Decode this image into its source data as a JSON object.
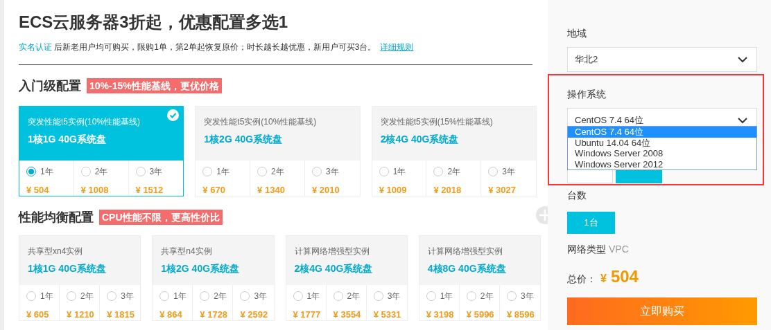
{
  "header": {
    "title": "ECS云服务器3折起，优惠配置多选1",
    "notice_link": "实名认证",
    "notice": "后新老用户均可购买，限购1单，第2单起恢复原价；时长越长越优惠，新用户可买3台。",
    "rules_link": "详细规则"
  },
  "sections": [
    {
      "title": "入门级配置",
      "tag": "10%-15%性能基线，更优价格",
      "cards": [
        {
          "type": "突发性能t5实例(10%性能基线)",
          "spec": "1核1G 40G系统盘",
          "selected": true,
          "options": [
            {
              "term": "1年",
              "price": "¥ 504",
              "selected": true
            },
            {
              "term": "2年",
              "price": "¥ 1008",
              "selected": false
            },
            {
              "term": "3年",
              "price": "¥ 1512",
              "selected": false
            }
          ]
        },
        {
          "type": "突发性能t5实例(10%性能基线)",
          "spec": "1核2G 40G系统盘",
          "selected": false,
          "options": [
            {
              "term": "1年",
              "price": "¥ 670",
              "selected": false
            },
            {
              "term": "2年",
              "price": "¥ 1340",
              "selected": false
            },
            {
              "term": "3年",
              "price": "¥ 2010",
              "selected": false
            }
          ]
        },
        {
          "type": "突发性能t5实例(15%性能基线)",
          "spec": "2核4G 40G系统盘",
          "selected": false,
          "options": [
            {
              "term": "1年",
              "price": "¥ 1009",
              "selected": false
            },
            {
              "term": "2年",
              "price": "¥ 2018",
              "selected": false
            },
            {
              "term": "3年",
              "price": "¥ 3027",
              "selected": false
            }
          ]
        }
      ]
    },
    {
      "title": "性能均衡配置",
      "tag": "CPU性能不限，更高性价比",
      "cards": [
        {
          "type": "共享型xn4实例",
          "spec": "1核1G 40G系统盘",
          "selected": false,
          "options": [
            {
              "term": "1年",
              "price": "¥ 605",
              "selected": false
            },
            {
              "term": "2年",
              "price": "¥ 1210",
              "selected": false
            },
            {
              "term": "3年",
              "price": "¥ 1815",
              "selected": false
            }
          ]
        },
        {
          "type": "共享型n4实例",
          "spec": "1核2G 40G系统盘",
          "selected": false,
          "options": [
            {
              "term": "1年",
              "price": "¥ 864",
              "selected": false
            },
            {
              "term": "2年",
              "price": "¥ 1728",
              "selected": false
            },
            {
              "term": "3年",
              "price": "¥ 2592",
              "selected": false
            }
          ]
        },
        {
          "type": "计算网络增强型实例",
          "spec": "2核4G 40G系统盘",
          "selected": false,
          "options": [
            {
              "term": "1年",
              "price": "¥ 1777",
              "selected": false
            },
            {
              "term": "2年",
              "price": "¥ 3554",
              "selected": false
            },
            {
              "term": "3年",
              "price": "¥ 5331",
              "selected": false
            }
          ]
        },
        {
          "type": "计算网络增强型实例",
          "spec": "4核8G 40G系统盘",
          "selected": false,
          "options": [
            {
              "term": "1年",
              "price": "¥ 3198",
              "selected": false
            },
            {
              "term": "2年",
              "price": "¥ 5996",
              "selected": false
            },
            {
              "term": "3年",
              "price": "¥ 8596",
              "selected": false
            }
          ]
        }
      ]
    }
  ],
  "side": {
    "region_label": "地域",
    "region_value": "华北2",
    "os_label": "操作系统",
    "os_value": "CentOS 7.4 64位",
    "os_options": [
      {
        "label": "CentOS 7.4 64位",
        "selected": true
      },
      {
        "label": "Ubuntu 14.04 64位",
        "selected": false
      },
      {
        "label": "Windows Server 2008",
        "selected": false
      },
      {
        "label": "Windows Server 2012",
        "selected": false
      }
    ],
    "count_label": "台数",
    "count_value": "1台",
    "network_label": "网络类型",
    "network_value": "VPC",
    "total_label": "总价：",
    "currency": "¥",
    "total": "504",
    "buy_button": "立即购买"
  }
}
